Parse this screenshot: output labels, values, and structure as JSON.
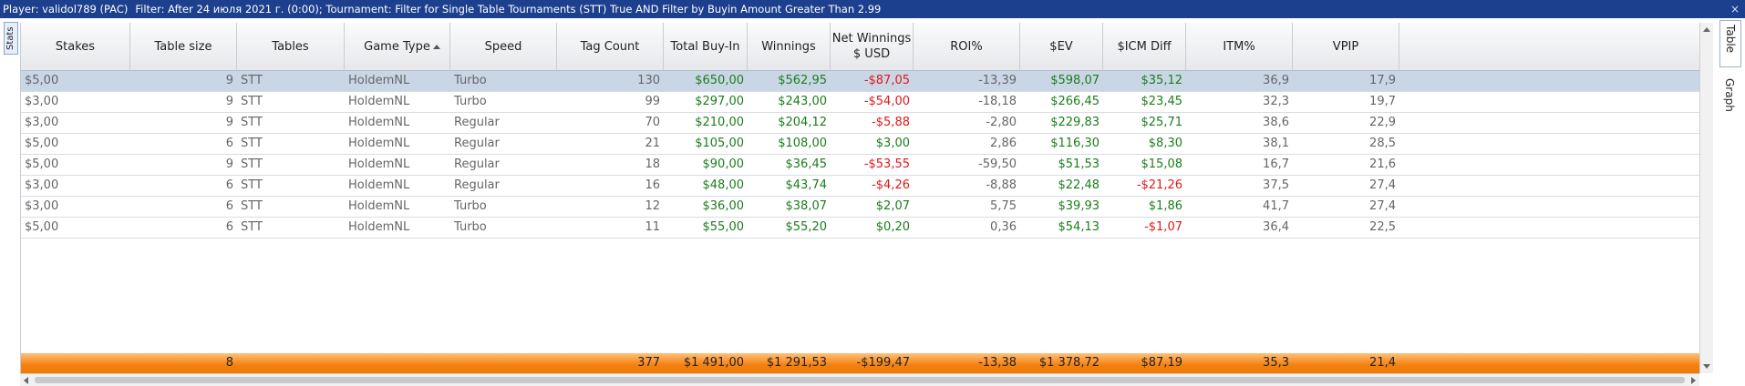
{
  "titlebar": {
    "player": "Player: validol789 (PAC)",
    "filter": "Filter: After 24 июля 2021 г. (0:00); Tournament: Filter for Single Table Tournaments (STT) True AND Filter by Buyin Amount Greater Than 2.99",
    "close": "×"
  },
  "left_tab": {
    "label": "Stats"
  },
  "side_tabs": {
    "table": "Table",
    "graph": "Graph"
  },
  "headers": [
    "Stakes",
    "Table size",
    "Tables",
    "Game Type",
    "Speed",
    "Tag Count",
    "Total Buy-In",
    "Winnings",
    "Net Winnings\n$ USD",
    "ROI%",
    "$EV",
    "$ICM Diff",
    "ITM%",
    "VPIP"
  ],
  "header_net_line1": "Net Winnings",
  "header_net_line2": "$ USD",
  "sorted_column": "Game Type",
  "rows": [
    {
      "stakes": "$5,00",
      "size": "9",
      "tables": "STT",
      "game": "HoldemNL",
      "speed": "Turbo",
      "tag": "130",
      "buyin": "$650,00",
      "win": "$562,95",
      "net": "-$87,05",
      "roi": "-13,39",
      "ev": "$598,07",
      "icm": "$35,12",
      "itm": "36,9",
      "vpip": "17,9"
    },
    {
      "stakes": "$3,00",
      "size": "9",
      "tables": "STT",
      "game": "HoldemNL",
      "speed": "Turbo",
      "tag": "99",
      "buyin": "$297,00",
      "win": "$243,00",
      "net": "-$54,00",
      "roi": "-18,18",
      "ev": "$266,45",
      "icm": "$23,45",
      "itm": "32,3",
      "vpip": "19,7"
    },
    {
      "stakes": "$3,00",
      "size": "9",
      "tables": "STT",
      "game": "HoldemNL",
      "speed": "Regular",
      "tag": "70",
      "buyin": "$210,00",
      "win": "$204,12",
      "net": "-$5,88",
      "roi": "-2,80",
      "ev": "$229,83",
      "icm": "$25,71",
      "itm": "38,6",
      "vpip": "22,9"
    },
    {
      "stakes": "$5,00",
      "size": "6",
      "tables": "STT",
      "game": "HoldemNL",
      "speed": "Regular",
      "tag": "21",
      "buyin": "$105,00",
      "win": "$108,00",
      "net": "$3,00",
      "roi": "2,86",
      "ev": "$116,30",
      "icm": "$8,30",
      "itm": "38,1",
      "vpip": "28,5"
    },
    {
      "stakes": "$5,00",
      "size": "9",
      "tables": "STT",
      "game": "HoldemNL",
      "speed": "Regular",
      "tag": "18",
      "buyin": "$90,00",
      "win": "$36,45",
      "net": "-$53,55",
      "roi": "-59,50",
      "ev": "$51,53",
      "icm": "$15,08",
      "itm": "16,7",
      "vpip": "21,6"
    },
    {
      "stakes": "$3,00",
      "size": "6",
      "tables": "STT",
      "game": "HoldemNL",
      "speed": "Regular",
      "tag": "16",
      "buyin": "$48,00",
      "win": "$43,74",
      "net": "-$4,26",
      "roi": "-8,88",
      "ev": "$22,48",
      "icm": "-$21,26",
      "itm": "37,5",
      "vpip": "27,4"
    },
    {
      "stakes": "$3,00",
      "size": "6",
      "tables": "STT",
      "game": "HoldemNL",
      "speed": "Turbo",
      "tag": "12",
      "buyin": "$36,00",
      "win": "$38,07",
      "net": "$2,07",
      "roi": "5,75",
      "ev": "$39,93",
      "icm": "$1,86",
      "itm": "41,7",
      "vpip": "27,4"
    },
    {
      "stakes": "$5,00",
      "size": "6",
      "tables": "STT",
      "game": "HoldemNL",
      "speed": "Turbo",
      "tag": "11",
      "buyin": "$55,00",
      "win": "$55,20",
      "net": "$0,20",
      "roi": "0,36",
      "ev": "$54,13",
      "icm": "-$1,07",
      "itm": "36,4",
      "vpip": "22,5"
    }
  ],
  "totals": {
    "size": "8",
    "tag": "377",
    "buyin": "$1 491,00",
    "win": "$1 291,53",
    "net": "-$199,47",
    "roi": "-13,38",
    "ev": "$1 378,72",
    "icm": "$87,19",
    "itm": "35,3",
    "vpip": "21,4"
  },
  "colors": {
    "positive": "#1b7d1b",
    "negative": "#e01818",
    "selected_row": "#c9d6e6",
    "total_row": "#f5800e",
    "titlebar": "#1c3f8e"
  }
}
